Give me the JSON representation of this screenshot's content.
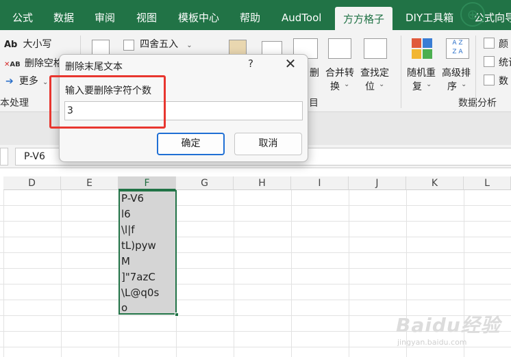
{
  "ribbon_tabs": [
    {
      "label": "公式"
    },
    {
      "label": "数据"
    },
    {
      "label": "审阅"
    },
    {
      "label": "视图"
    },
    {
      "label": "模板中心"
    },
    {
      "label": "帮助"
    },
    {
      "label": "AudTool"
    },
    {
      "label": "方方格子",
      "active": true
    },
    {
      "label": "DIY工具箱"
    },
    {
      "label": "公式向导"
    }
  ],
  "ribbon": {
    "case_btn": {
      "prefix": "Ab",
      "label": "大小写"
    },
    "trim_btn": {
      "prefix": "AB",
      "label": "删除空格"
    },
    "more_btn": {
      "label": "更多"
    },
    "round_btn": {
      "label": "四舍五入"
    },
    "text_group_label": "本处理",
    "delete_partial": "删",
    "merge_convert": {
      "line1": "合并转",
      "line2": "换"
    },
    "find_locate": {
      "line1": "查找定",
      "line2": "位"
    },
    "group_partial_label": "目",
    "random_repeat": {
      "line1": "随机重",
      "line2": "复"
    },
    "advanced_sort": {
      "line1": "高级排",
      "line2": "序"
    },
    "analysis_group_label": "数据分析",
    "right_items": [
      "颜",
      "统计",
      "数"
    ]
  },
  "formula_bar": {
    "value": "P-V6"
  },
  "columns": [
    "D",
    "E",
    "F",
    "G",
    "H",
    "I",
    "J",
    "K",
    "L"
  ],
  "selected_column": "F",
  "cells_f": [
    "P-V6",
    "l6",
    "\\l|f",
    "tL)pyw",
    "M",
    "]\"7azC",
    "\\L@q0s",
    "o"
  ],
  "dialog": {
    "title": "删除末尾文本",
    "help": "?",
    "close": "✕",
    "prompt": "输入要删除字符个数",
    "input_value": "3",
    "ok_label": "确定",
    "cancel_label": "取消"
  },
  "watermark": {
    "main": "Baidu经验",
    "sub": "jingyan.baidu.com"
  },
  "colors": {
    "excel_green": "#217346",
    "highlight_red": "#e8362f",
    "primary_blue": "#1f6fd4"
  }
}
